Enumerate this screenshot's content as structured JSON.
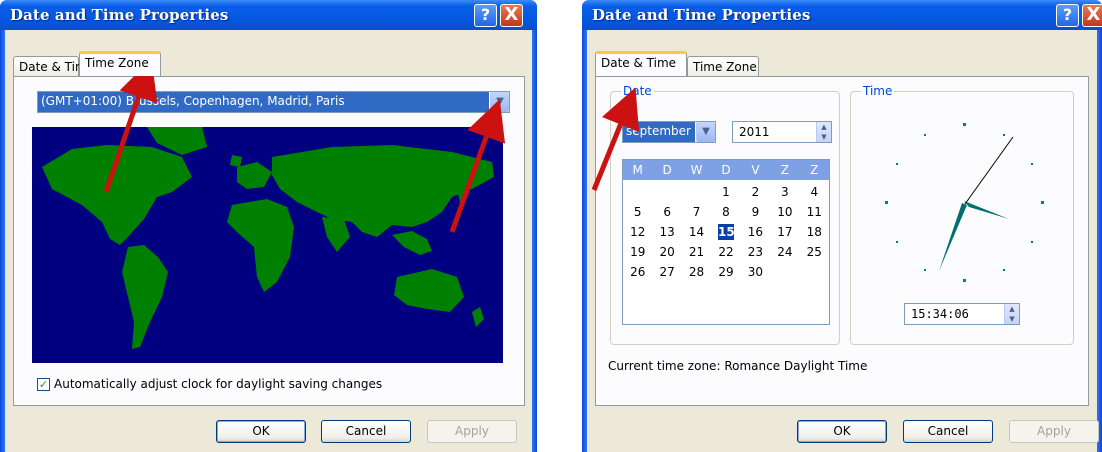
{
  "left_window": {
    "title": "Date and Time Properties",
    "help_glyph": "?",
    "close_glyph": "X",
    "tabs": [
      {
        "label": "Date & Time",
        "active": false
      },
      {
        "label": "Time Zone",
        "active": true
      }
    ],
    "timezone": {
      "value": "(GMT+01:00) Brussels, Copenhagen, Madrid, Paris"
    },
    "daylight_check": {
      "label": "Automatically adjust clock for daylight saving changes",
      "checked": true
    },
    "buttons": {
      "ok": "OK",
      "cancel": "Cancel",
      "apply": "Apply"
    }
  },
  "right_window": {
    "title": "Date and Time Properties",
    "help_glyph": "?",
    "close_glyph": "X",
    "tabs": [
      {
        "label": "Date & Time",
        "active": true
      },
      {
        "label": "Time Zone",
        "active": false
      }
    ],
    "date_group": {
      "label": "Date",
      "month": "september",
      "year": "2011"
    },
    "calendar": {
      "weekday_headers": [
        "M",
        "D",
        "W",
        "D",
        "V",
        "Z",
        "Z"
      ],
      "weeks": [
        [
          "",
          "",
          "",
          "1",
          "2",
          "3",
          "4"
        ],
        [
          "5",
          "6",
          "7",
          "8",
          "9",
          "10",
          "11"
        ],
        [
          "12",
          "13",
          "14",
          "15",
          "16",
          "17",
          "18"
        ],
        [
          "19",
          "20",
          "21",
          "22",
          "23",
          "24",
          "25"
        ],
        [
          "26",
          "27",
          "28",
          "29",
          "30",
          "",
          ""
        ]
      ],
      "selected_day": "15"
    },
    "time_group": {
      "label": "Time",
      "time": "15:34:06"
    },
    "current_timezone": {
      "label": "Current time zone:",
      "value": "Romance Daylight Time"
    },
    "buttons": {
      "ok": "OK",
      "cancel": "Cancel",
      "apply": "Apply"
    }
  },
  "colors": {
    "title_bar": "#0458e0",
    "dialog_bg": "#ece9d8",
    "map_ocean": "#000080",
    "map_land": "#008000",
    "annotation_arrow": "#cc1111",
    "selection": "#316ac5"
  },
  "icons": {
    "help": "help-icon",
    "close": "close-icon",
    "dropdown": "chevron-down-icon",
    "spinner": "spinner-arrows-icon",
    "checkbox": "check-icon"
  }
}
